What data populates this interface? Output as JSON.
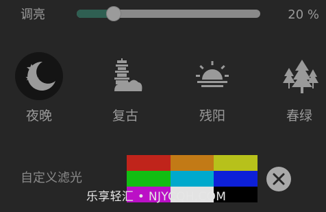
{
  "brightness": {
    "label": "调亮",
    "value_text": "20 %",
    "level": 0.2
  },
  "modes": [
    {
      "label": "夜晚",
      "icon": "moon-stars-icon",
      "active": true
    },
    {
      "label": "复古",
      "icon": "pagoda-icon",
      "active": false
    },
    {
      "label": "残阳",
      "icon": "sunset-icon",
      "active": false
    },
    {
      "label": "春绿",
      "icon": "pine-trees-icon",
      "active": false
    }
  ],
  "custom_filter": {
    "label": "自定义滤光",
    "clear_icon": "close-icon",
    "swatches": [
      "#c0241b",
      "#c27a16",
      "#b7c11b",
      "#12bd12",
      "#00a9cc",
      "#0d20d8",
      "#bb10c6",
      "#e3e3e3",
      "#000000"
    ]
  },
  "watermark": "乐享轻汇 • NJYCQH.COM",
  "colors": {
    "background": "#262626",
    "slider_fill": "#2f5f52",
    "text": "#9a9a9a"
  }
}
